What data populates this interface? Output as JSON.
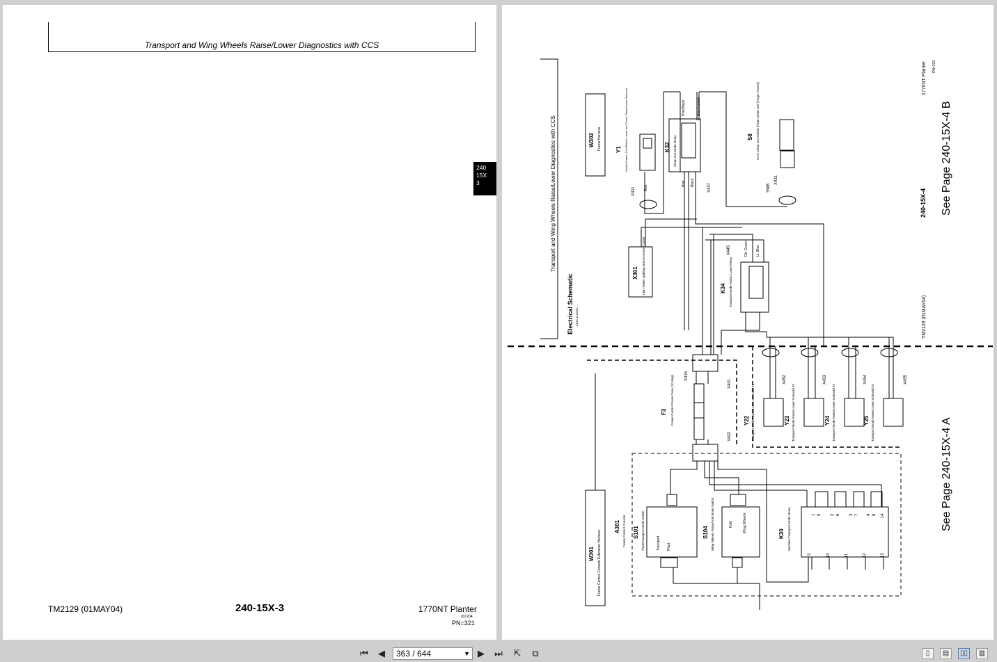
{
  "left_page": {
    "header_title": "Transport and Wing Wheels Raise/Lower Diagnostics with CCS",
    "tab": [
      "240",
      "15X",
      "3"
    ],
    "footer": {
      "doc": "TM2129 (01MAY04)",
      "page": "240-15X-3",
      "model": "1770NT Planter",
      "date_code": "031204",
      "pn": "PN=321"
    }
  },
  "right_page": {
    "schematic_title": "Electrical Schematic",
    "schematic_sub": "AB43 4148450 ...",
    "side_title": "Transport and Wing Wheels Raise/Lower Diagnostics with CCS",
    "see_page_b": "See Page 240-15X-4 B",
    "see_page_a": "See Page 240-15X-4 A",
    "page_ref": "240-15X-4",
    "doc_ref": "TM2129 (01MAY04)",
    "model_ref": "1770NT Planter",
    "pn_ref": "PN=322",
    "w302": {
      "id": "W302",
      "name": "Frame Harness"
    },
    "w301": {
      "id": "W301",
      "name": "Frame Control Console Extension Harness"
    },
    "y1": {
      "id": "Y1",
      "name": "Center Frame, Fold Raise/ Lower, and Trans. Raise/Lower Solenoid"
    },
    "k32": {
      "id": "K32",
      "name": "Clean Out Mode Relay"
    },
    "s8": {
      "id": "S8",
      "name": "CCS Clean Out Switch (Plant-Clean Out (Purge Hoses))"
    },
    "x301": {
      "id": "X301",
      "name": "7 pin Trailer Lighting and Accessory Outlet"
    },
    "k34": {
      "id": "K34",
      "name": "Transport Mode Raise/ Lower Relay"
    },
    "f3": {
      "id": "F3",
      "name": "Frame Control Power Fuse (10 Amp)"
    },
    "a301": {
      "id": "A301",
      "name": "Frame Control Console"
    },
    "s101": {
      "id": "S101",
      "name": "Plant/Transport Mode Switch",
      "pos1": "Transport",
      "pos2": "Plant"
    },
    "s104": {
      "id": "S104",
      "name": "Wing Wheels Raise/Fold Mode Switch",
      "pos1": "Fold",
      "pos2": "Wing Wheels"
    },
    "k30": {
      "id": "K30",
      "name": "Machine Transport Mode Relay"
    },
    "solenoids": [
      {
        "id": "Y22",
        "conn": "X452",
        "name": "Transport Mode Raise/Lower Solenoid #1"
      },
      {
        "id": "Y23",
        "conn": "X453",
        "name": "Transport Mode Raise/Lower Solenoid #2"
      },
      {
        "id": "Y24",
        "conn": "X454",
        "name": "Transport Mode Raise/Lower Solenoid #3"
      },
      {
        "id": "Y25",
        "conn": "X455",
        "name": "Transport Mode Raise/Lower Solenoid #4"
      }
    ],
    "connectors": [
      "X411",
      "X437",
      "X431",
      "SW8",
      "X445",
      "X416",
      "X401",
      "X402"
    ],
    "wire_colors": [
      "Pink/Black",
      "Black/Green",
      "Pink",
      "Black",
      "Red",
      "Dk. Green",
      "Lt. Blue"
    ],
    "k30_pins": [
      "1",
      "5",
      "2",
      "6",
      "3",
      "7",
      "4",
      "8",
      "14",
      "9",
      "10",
      "11",
      "12",
      "13"
    ]
  },
  "toolbar": {
    "page_indicator": "363 / 644"
  },
  "icons": {
    "first": "first-page-icon",
    "prev": "prev-page-icon",
    "next": "next-page-icon",
    "last": "last-page-icon"
  }
}
